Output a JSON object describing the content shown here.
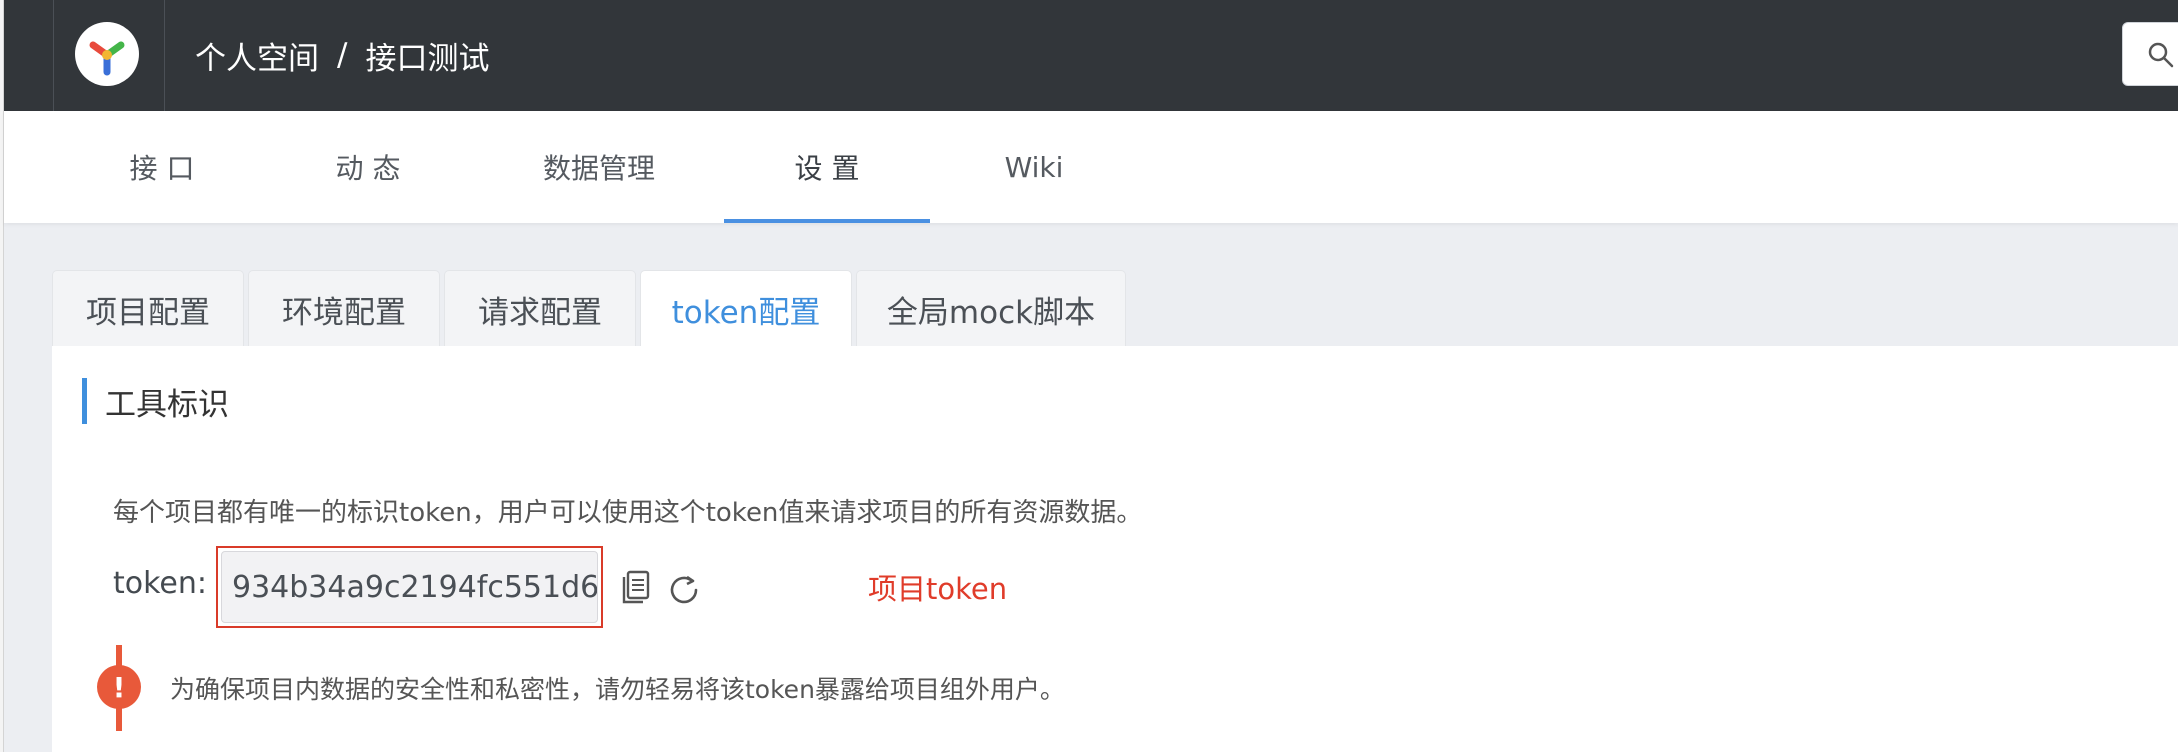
{
  "header": {
    "logo_icon": "yapi-logo-icon",
    "breadcrumb": [
      "个人空间",
      "/",
      "接口测试"
    ],
    "search_icon": "search-icon"
  },
  "main_nav": {
    "items": [
      {
        "label": "接 口"
      },
      {
        "label": "动 态"
      },
      {
        "label": "数据管理"
      },
      {
        "label": "设 置",
        "active": true
      },
      {
        "label": "Wiki"
      }
    ]
  },
  "settings_tabs": [
    {
      "label": "项目配置"
    },
    {
      "label": "环境配置"
    },
    {
      "label": "请求配置"
    },
    {
      "label": "token配置",
      "active": true
    },
    {
      "label": "全局mock脚本"
    }
  ],
  "token_section": {
    "title": "工具标识",
    "description": "每个项目都有唯一的标识token，用户可以使用这个token值来请求项目的所有资源数据。",
    "token_label": "token:",
    "token_value": "934b34a9c2194fc551d6",
    "copy_icon": "copy-icon",
    "refresh_icon": "refresh-icon",
    "annotation": "项目token",
    "warning_icon": "exclamation-icon",
    "warning_symbol": "!",
    "warning_text": "为确保项目内数据的安全性和私密性，请勿轻易将该token暴露给项目组外用户。"
  },
  "colors": {
    "header_bg": "#32363a",
    "accent": "#4a90e2",
    "highlight_red": "#d93b29",
    "warning": "#e8593a"
  }
}
